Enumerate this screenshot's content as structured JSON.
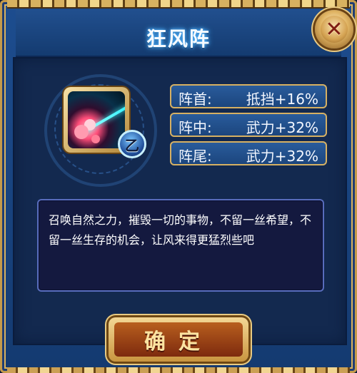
{
  "dialog": {
    "title": "狂风阵",
    "close_icon": "close-icon",
    "close_symbol": "✕"
  },
  "skill": {
    "icon_name": "storm-petal-skill-icon",
    "grade": "乙",
    "stats": [
      {
        "label": "阵首:",
        "value": "抵挡+16%"
      },
      {
        "label": "阵中:",
        "value": "武力+32%"
      },
      {
        "label": "阵尾:",
        "value": "武力+32%"
      }
    ],
    "description": "召唤自然之力，摧毁一切的事物，不留一丝希望，不留一丝生存的机会，让风来得更猛烈些吧"
  },
  "footer": {
    "confirm_label": "确定"
  },
  "colors": {
    "frame_gold": "#d9b25f",
    "panel_blue": "#13294f",
    "accent_blue": "#4fb4ff",
    "button_red": "#7d2a0e"
  }
}
